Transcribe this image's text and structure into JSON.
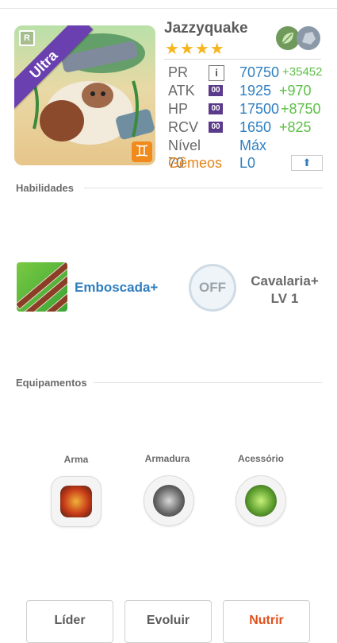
{
  "monster": {
    "name": "Jazzyquake",
    "stars": "★★★★",
    "rarity_letter": "R",
    "rarity": "Ultra",
    "zodiac_glyph": "♊",
    "element_icons": [
      "leaf-icon",
      "rock-icon"
    ]
  },
  "stats": {
    "pr": {
      "label": "PR",
      "value": "70750",
      "bonus": "+35452"
    },
    "atk": {
      "label": "ATK",
      "value": "1925",
      "bonus": "+970",
      "badge": "00"
    },
    "hp": {
      "label": "HP",
      "value": "17500",
      "bonus": "+8750",
      "badge": "00"
    },
    "rcv": {
      "label": "RCV",
      "value": "1650",
      "bonus": "+825",
      "badge": "00"
    },
    "level": {
      "label": "Nível 70",
      "value": "Máx"
    },
    "sign": {
      "label": "Gêmeos",
      "value": "L0",
      "button_glyph": "⬆"
    }
  },
  "info_glyph": "i",
  "sections": {
    "skills": "Habilidades",
    "equipment": "Equipamentos"
  },
  "skills": {
    "active_name": "Emboscada+",
    "leader_toggle": "OFF",
    "leader_name": "Cavalaria+",
    "leader_level": "LV 1"
  },
  "equipment": {
    "weapon": "Arma",
    "armor": "Armadura",
    "accessory": "Acessório"
  },
  "actions": {
    "leader": "Líder",
    "evolve": "Evoluir",
    "feed": "Nutrir"
  },
  "colors": {
    "accent_blue": "#2f7fc0",
    "bonus_green": "#5cbf45",
    "sign_orange": "#e5851a",
    "ultra_purple": "#6a3fb0",
    "feed_orange": "#e0521f"
  }
}
